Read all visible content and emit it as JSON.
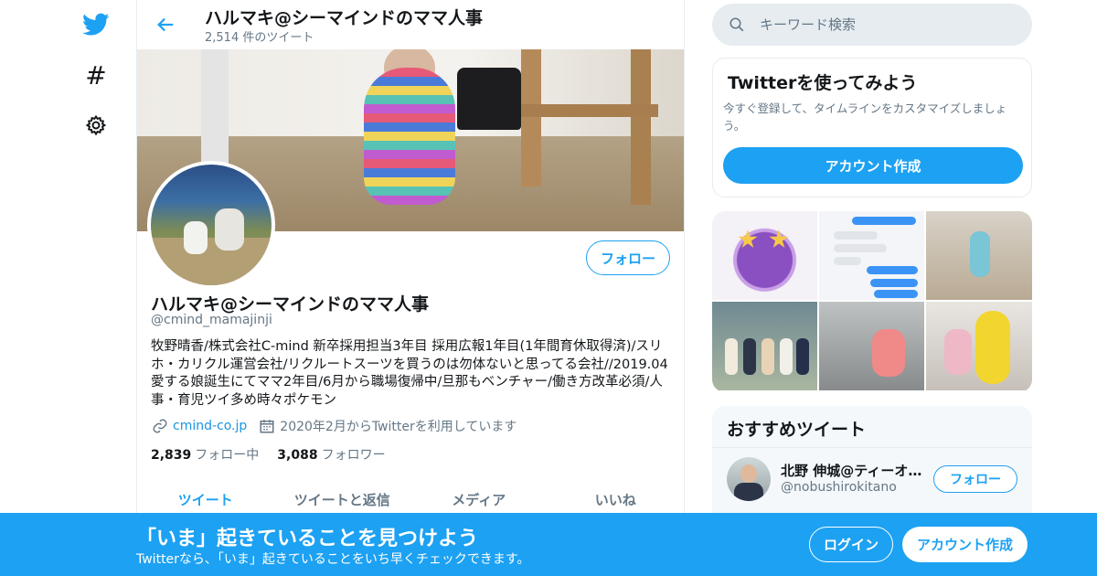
{
  "nav": {
    "bird_icon": "twitter-bird-icon",
    "hash_glyph": "#",
    "gear_icon": "gear-icon"
  },
  "header": {
    "name": "ハルマキ@シーマインドのママ人事",
    "tweet_count": "2,514 件のツイート"
  },
  "profile": {
    "follow_label": "フォロー",
    "name": "ハルマキ@シーマインドのママ人事",
    "handle": "@cmind_mamajinji",
    "bio": "牧野晴香/株式会社C-mind 新卒採用担当3年目 採用広報1年目(1年間育休取得済)/スリホ・カリクル運営会社/リクルートスーツを買うのは勿体ないと思ってる会社//2019.04愛する娘誕生にてママ2年目/6月から職場復帰中/旦那もベンチャー/働き方改革必須/人事・育児ツイ多め時々ポケモン",
    "website": "cmind-co.jp",
    "joined": "2020年2月からTwitterを利用しています",
    "following_count": "2,839",
    "following_label": "フォロー中",
    "followers_count": "3,088",
    "followers_label": "フォロワー"
  },
  "tabs": [
    {
      "label": "ツイート"
    },
    {
      "label": "ツイートと返信"
    },
    {
      "label": "メディア"
    },
    {
      "label": "いいね"
    }
  ],
  "search": {
    "placeholder": "キーワード検索"
  },
  "try_card": {
    "title": "Twitterを使ってみよう",
    "description": "今すぐ登録して、タイムラインをカスタマイズしましょう。",
    "button": "アカウント作成"
  },
  "recommended": {
    "title": "おすすめツイート",
    "user_name": "北野 伸城@ティーオ…",
    "user_handle": "@nobushirokitano",
    "follow_label": "フォロー"
  },
  "bottom_bar": {
    "title": "「いま」起きていることを見つけよう",
    "subtitle": "Twitterなら、「いま」起きていることをいち早くチェックできます。",
    "login": "ログイン",
    "signup": "アカウント作成"
  },
  "colors": {
    "accent": "#1da1f2",
    "text": "#14171a",
    "muted": "#657786",
    "border": "#e6ecf0"
  }
}
